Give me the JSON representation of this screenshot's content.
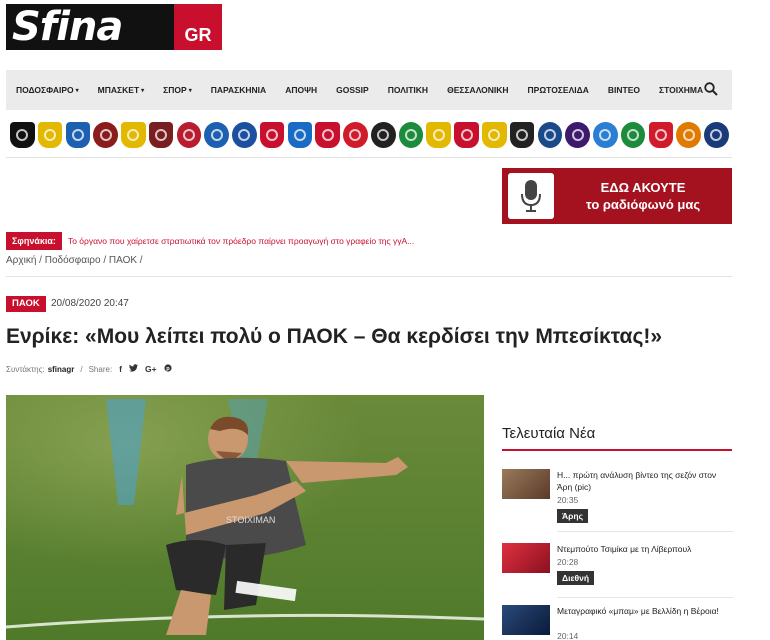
{
  "logo": {
    "main": "Sfina",
    "suffix": "GR"
  },
  "nav": {
    "items": [
      {
        "label": "ΠΟΔΟΣΦΑΙΡΟ",
        "dropdown": true
      },
      {
        "label": "ΜΠΑΣΚΕΤ",
        "dropdown": true
      },
      {
        "label": "ΣΠΟΡ",
        "dropdown": true
      },
      {
        "label": "ΠΑΡΑΣΚΗΝΙΑ",
        "dropdown": false
      },
      {
        "label": "ΑΠΟΨΗ",
        "dropdown": false
      },
      {
        "label": "GOSSIP",
        "dropdown": false
      },
      {
        "label": "ΠΟΛΙΤΙΚΗ",
        "dropdown": false
      },
      {
        "label": "ΘΕΣΣΑΛΟΝΙΚΗ",
        "dropdown": false
      },
      {
        "label": "ΠΡΩΤΟΣΕΛΙΔΑ",
        "dropdown": false
      },
      {
        "label": "ΒΙΝΤΕΟ",
        "dropdown": false
      },
      {
        "label": "ΣΤΟΙΧΗΜΑ",
        "dropdown": false
      }
    ],
    "search_icon": "search-icon",
    "caret": "▾"
  },
  "clubs": [
    {
      "color": "#111",
      "shape": "shield"
    },
    {
      "color": "#e3b800",
      "shape": "shield"
    },
    {
      "color": "#1d5fb0",
      "shape": "shield"
    },
    {
      "color": "#8a1c1c",
      "shape": "circle"
    },
    {
      "color": "#e3b800",
      "shape": "shield"
    },
    {
      "color": "#7a1f1f",
      "shape": "shield"
    },
    {
      "color": "#b81c2e",
      "shape": "circle"
    },
    {
      "color": "#1d5fb0",
      "shape": "circle"
    },
    {
      "color": "#1d4fa0",
      "shape": "circle"
    },
    {
      "color": "#c8102e",
      "shape": "shield"
    },
    {
      "color": "#1a6bc4",
      "shape": "shield"
    },
    {
      "color": "#c8102e",
      "shape": "shield"
    },
    {
      "color": "#d11a2a",
      "shape": "circle"
    },
    {
      "color": "#222",
      "shape": "circle"
    },
    {
      "color": "#1c8b3c",
      "shape": "circle"
    },
    {
      "color": "#e3b800",
      "shape": "shield"
    },
    {
      "color": "#c8102e",
      "shape": "shield"
    },
    {
      "color": "#e3b800",
      "shape": "shield"
    },
    {
      "color": "#222",
      "shape": "shield"
    },
    {
      "color": "#1a4a8a",
      "shape": "circle"
    },
    {
      "color": "#3d1a6e",
      "shape": "circle"
    },
    {
      "color": "#2a7fd4",
      "shape": "circle"
    },
    {
      "color": "#1c8b3c",
      "shape": "circle"
    },
    {
      "color": "#d11a2a",
      "shape": "shield"
    },
    {
      "color": "#e07a00",
      "shape": "circle"
    },
    {
      "color": "#1a3a7a",
      "shape": "circle"
    }
  ],
  "radio": {
    "line1": "ΕΔΩ ΑΚΟΥΤΕ",
    "line2": "το ραδιόφωνό μας"
  },
  "breaking": {
    "label": "Σφηνάκια:",
    "text": "Το όργανο που χαίρετσε στρατιωτικά τον πρόεδρο παίρνει προαγωγή στο γραφείο της γγΑ..."
  },
  "breadcrumb": "Αρχική / Ποδόσφαιρο / ΠΑΟΚ /",
  "article": {
    "category": "ΠΑΟΚ",
    "date": "20/08/2020 20:47",
    "headline": "Ενρίκε: «Μου λείπει πολύ ο ΠΑΟΚ – Θα κερδίσει την Μπεσίκτας!»",
    "author_label": "Συντάκτης:",
    "author": "sfinagr",
    "share_label": "Share:",
    "share_icons": [
      "f",
      "🐦",
      "G+",
      "℗"
    ]
  },
  "sidebar": {
    "title": "Τελευταία Νέα",
    "news": [
      {
        "title": "Η... πρώτη ανάλυση βίντεο της σεζόν στον Άρη (pic)",
        "time": "20:35",
        "tag": "Άρης",
        "thumb": "#7a5a3c"
      },
      {
        "title": "Ντεμπούτο Τσιμίκα με τη Λίβερπουλ",
        "time": "20:28",
        "tag": "Διεθνή",
        "thumb": "#c8102e"
      },
      {
        "title": "Μεταγραφικό «μπαμ» με Βελλίδη η Βέροια!",
        "time": "20:14",
        "tag": "",
        "thumb": "#1a3a6a"
      }
    ]
  }
}
